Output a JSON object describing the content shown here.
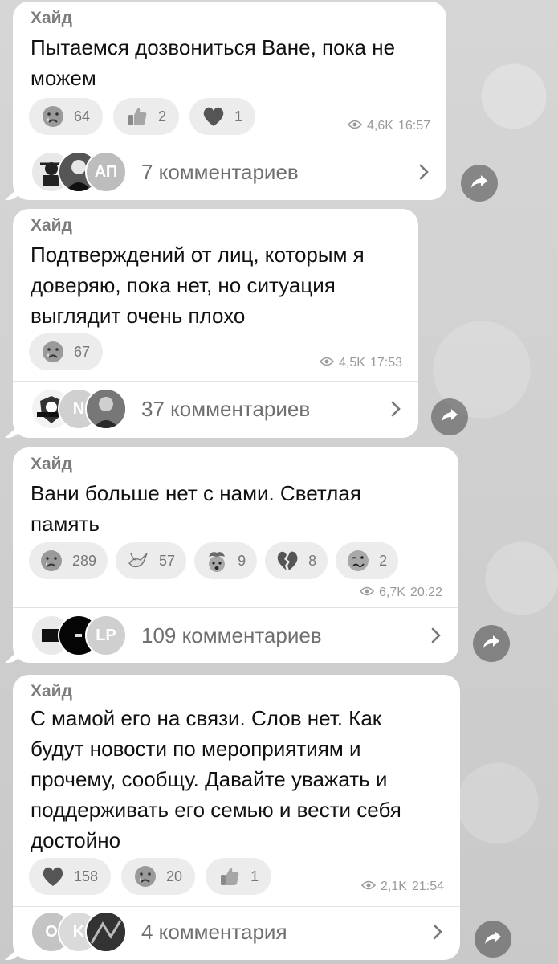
{
  "messages": [
    {
      "author": "Хайд",
      "text_lines": [
        "Пытаемся дозвониться Ване, пока не",
        "можем"
      ],
      "reactions": [
        {
          "icon": "crying-face-icon",
          "count": "64"
        },
        {
          "icon": "thumbs-up-icon",
          "count": "2"
        },
        {
          "icon": "heart-icon",
          "count": "1"
        }
      ],
      "views": "4,6K",
      "time": "16:57",
      "comments": "7 комментариев",
      "avatar_initials": [
        "",
        "",
        "АП"
      ]
    },
    {
      "author": "Хайд",
      "text_lines": [
        "Подтверждений от лиц, которым я",
        "доверяю, пока нет, но ситуация",
        "выглядит очень плохо"
      ],
      "reactions": [
        {
          "icon": "crying-face-icon",
          "count": "67"
        }
      ],
      "views": "4,5K",
      "time": "17:53",
      "comments": "37 комментариев",
      "avatar_initials": [
        "",
        "N",
        ""
      ]
    },
    {
      "author": "Хайд",
      "text_lines": [
        "Вани больше нет с нами. Светлая",
        "память"
      ],
      "reactions": [
        {
          "icon": "crying-face-icon",
          "count": "289"
        },
        {
          "icon": "dove-icon",
          "count": "57"
        },
        {
          "icon": "exploding-head-icon",
          "count": "9"
        },
        {
          "icon": "broken-heart-icon",
          "count": "8"
        },
        {
          "icon": "woozy-face-icon",
          "count": "2"
        }
      ],
      "views": "6,7K",
      "time": "20:22",
      "comments": "109 комментариев",
      "avatar_initials": [
        "",
        "",
        "LP"
      ]
    },
    {
      "author": "Хайд",
      "text_lines": [
        "С мамой его на связи. Слов нет. Как",
        "будут новости по мероприятиям и",
        "прочему, сообщу. Давайте уважать и",
        "поддерживать его семью и вести себя",
        "достойно"
      ],
      "reactions": [
        {
          "icon": "heart-icon",
          "count": "158"
        },
        {
          "icon": "crying-face-icon",
          "count": "20"
        },
        {
          "icon": "thumbs-up-icon",
          "count": "1"
        }
      ],
      "views": "2,1K",
      "time": "21:54",
      "comments": "4 комментария",
      "avatar_initials": [
        "O",
        "K",
        ""
      ]
    }
  ]
}
